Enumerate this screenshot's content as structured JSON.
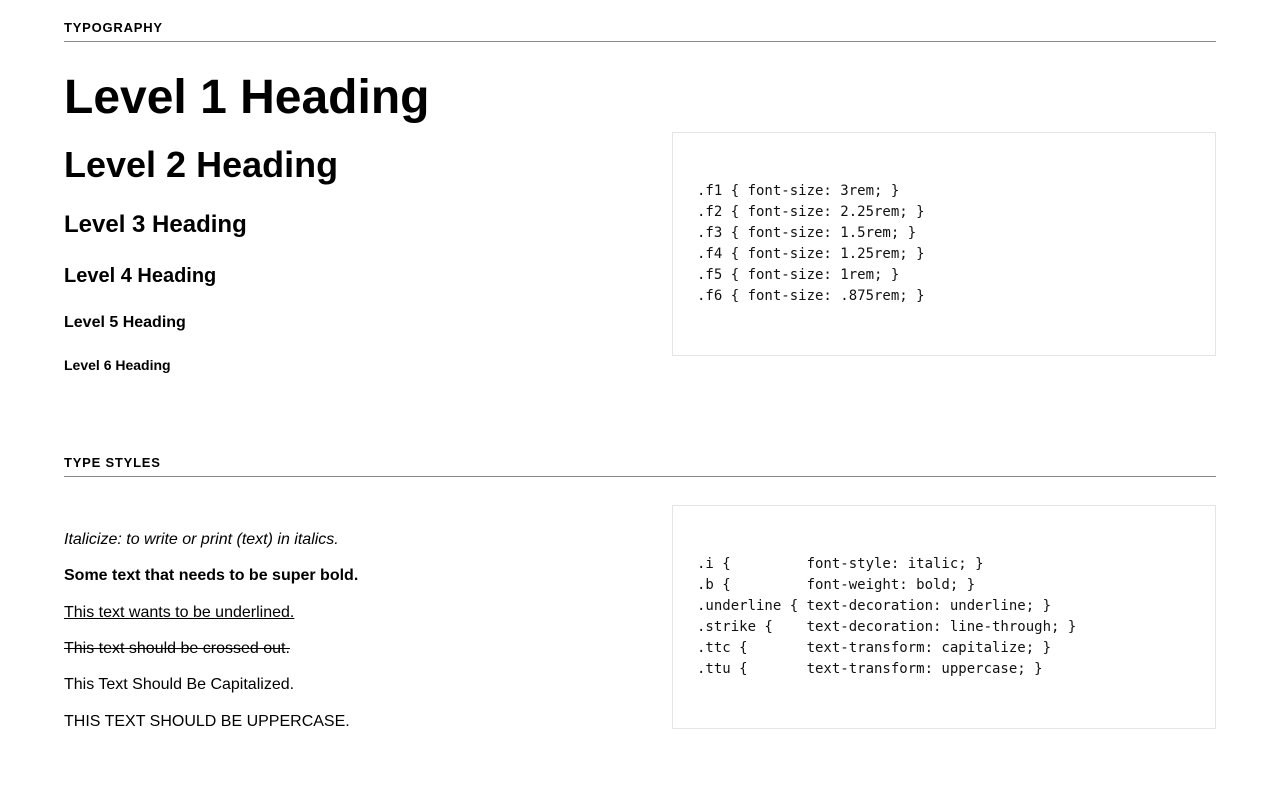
{
  "sections": {
    "typography": {
      "label": "Typography",
      "headings": {
        "h1": "Level 1 Heading",
        "h2": "Level 2 Heading",
        "h3": "Level 3 Heading",
        "h4": "Level 4 Heading",
        "h5": "Level 5 Heading",
        "h6": "Level 6 Heading"
      },
      "code": ".f1 { font-size: 3rem; }\n.f2 { font-size: 2.25rem; }\n.f3 { font-size: 1.5rem; }\n.f4 { font-size: 1.25rem; }\n.f5 { font-size: 1rem; }\n.f6 { font-size: .875rem; }"
    },
    "type_styles": {
      "label": "Type Styles",
      "examples": {
        "italic": "Italicize: to write or print (text) in italics.",
        "bold": "Some text that needs to be super bold.",
        "underline": "This text wants to be underlined.",
        "strike": "This text should be crossed out.",
        "capitalize": "this text should be capitalized.",
        "uppercase": "this text should be uppercase."
      },
      "code": ".i {         font-style: italic; }\n.b {         font-weight: bold; }\n.underline { text-decoration: underline; }\n.strike {    text-decoration: line-through; }\n.ttc {       text-transform: capitalize; }\n.ttu {       text-transform: uppercase; }"
    }
  }
}
